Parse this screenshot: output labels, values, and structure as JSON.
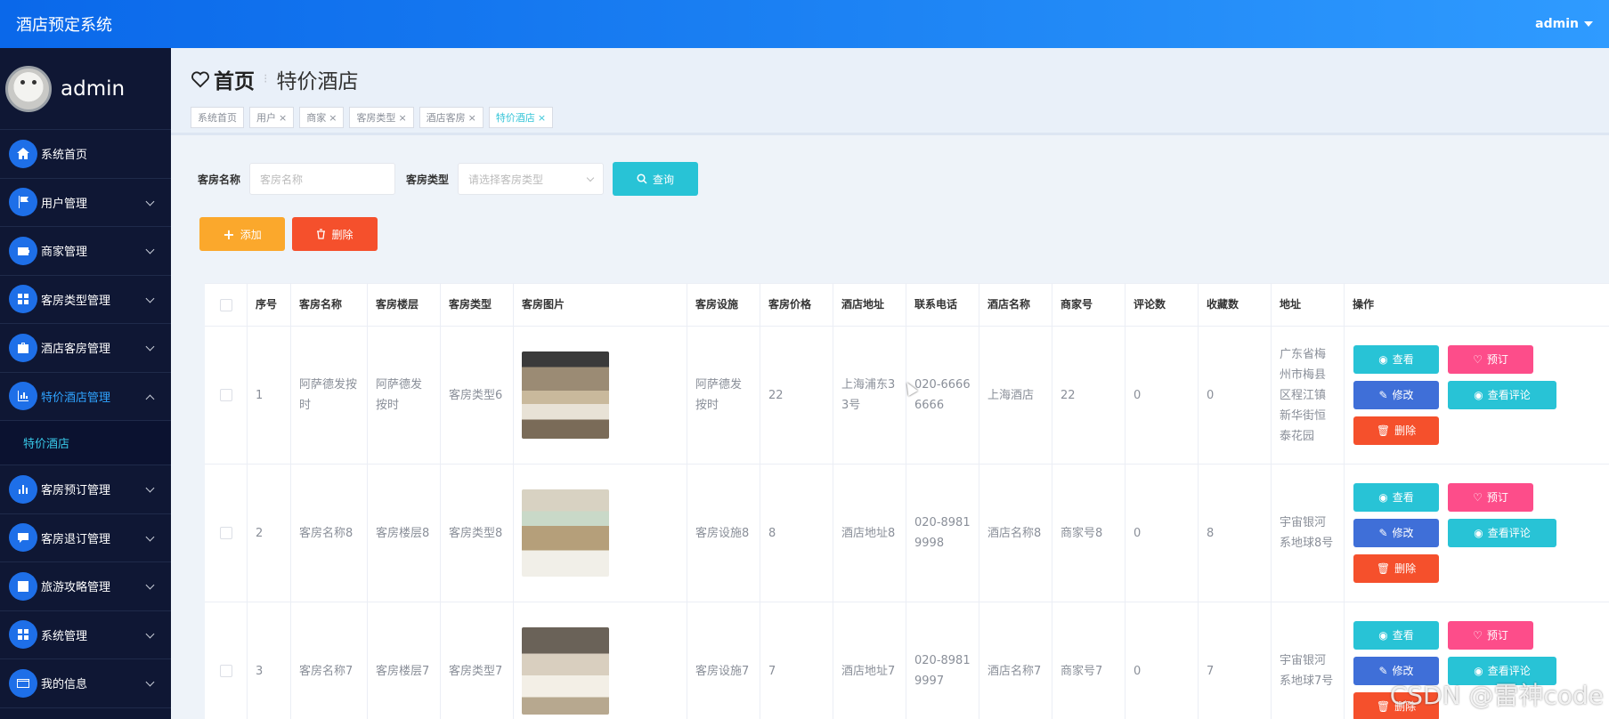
{
  "topbar": {
    "title": "酒店预定系统",
    "user": "admin"
  },
  "sidebar": {
    "username": "admin",
    "items": [
      {
        "label": "系统首页",
        "icon": "home-icon"
      },
      {
        "label": "用户管理",
        "icon": "flag-icon"
      },
      {
        "label": "商家管理",
        "icon": "wallet-icon"
      },
      {
        "label": "客房类型管理",
        "icon": "grid-icon"
      },
      {
        "label": "酒店客房管理",
        "icon": "briefcase-icon"
      },
      {
        "label": "特价酒店管理",
        "icon": "chart-icon"
      },
      {
        "label": "客房预订管理",
        "icon": "bar-chart-icon"
      },
      {
        "label": "客房退订管理",
        "icon": "chat-icon"
      },
      {
        "label": "旅游攻略管理",
        "icon": "trend-icon"
      },
      {
        "label": "系统管理",
        "icon": "apps-icon"
      },
      {
        "label": "我的信息",
        "icon": "card-icon"
      }
    ],
    "submenu": "特价酒店"
  },
  "breadcrumb": {
    "home": "首页",
    "current": "特价酒店"
  },
  "tags": [
    "系统首页",
    "用户",
    "商家",
    "客房类型",
    "酒店客房",
    "特价酒店"
  ],
  "search": {
    "name_label": "客房名称",
    "name_placeholder": "客房名称",
    "type_label": "客房类型",
    "type_placeholder": "请选择客房类型",
    "search_button": "查询"
  },
  "actions": {
    "add": "添加",
    "delete": "删除"
  },
  "table": {
    "headers": [
      "序号",
      "客房名称",
      "客房楼层",
      "客房类型",
      "客房图片",
      "客房设施",
      "客房价格",
      "酒店地址",
      "联系电话",
      "酒店名称",
      "商家号",
      "评论数",
      "收藏数",
      "地址",
      "操作"
    ],
    "rows": [
      {
        "no": "1",
        "name": "阿萨德发按时",
        "floor": "阿萨德发按时",
        "type": "客房类型6",
        "facility": "阿萨德发按时",
        "price": "22",
        "hotel_addr": "上海浦东33号",
        "phone": "020-66666666",
        "hotel_name": "上海酒店",
        "merchant": "22",
        "comments": "0",
        "favorites": "0",
        "address": "广东省梅州市梅县区程江镇新华街恒泰花园"
      },
      {
        "no": "2",
        "name": "客房名称8",
        "floor": "客房楼层8",
        "type": "客房类型8",
        "facility": "客房设施8",
        "price": "8",
        "hotel_addr": "酒店地址8",
        "phone": "020-89819998",
        "hotel_name": "酒店名称8",
        "merchant": "商家号8",
        "comments": "0",
        "favorites": "8",
        "address": "宇宙银河系地球8号"
      },
      {
        "no": "3",
        "name": "客房名称7",
        "floor": "客房楼层7",
        "type": "客房类型7",
        "facility": "客房设施7",
        "price": "7",
        "hotel_addr": "酒店地址7",
        "phone": "020-89819997",
        "hotel_name": "酒店名称7",
        "merchant": "商家号7",
        "comments": "0",
        "favorites": "7",
        "address": "宇宙银河系地球7号"
      }
    ],
    "ops": {
      "view": "查看",
      "book": "预订",
      "edit": "修改",
      "review": "查看评论",
      "delete": "删除"
    }
  },
  "watermark": "CSDN @雷神code"
}
